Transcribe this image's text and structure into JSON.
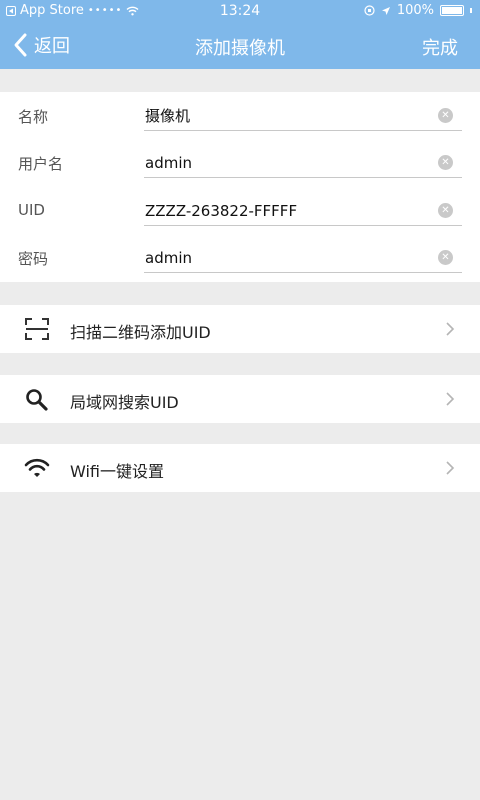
{
  "status_bar": {
    "carrier": "App Store",
    "signal": "•••••",
    "time": "13:24",
    "battery": "100%"
  },
  "nav": {
    "back_label": "返回",
    "title": "添加摄像机",
    "done_label": "完成"
  },
  "form": {
    "fields": [
      {
        "label": "名称",
        "value": "摄像机"
      },
      {
        "label": "用户名",
        "value": "admin"
      },
      {
        "label": "UID",
        "value": "ZZZZ-263822-FFFFF"
      },
      {
        "label": "密码",
        "value": "admin"
      }
    ]
  },
  "actions": [
    {
      "label": "扫描二维码添加UID",
      "icon": "qr-scan-icon"
    },
    {
      "label": "局域网搜索UID",
      "icon": "search-icon"
    },
    {
      "label": "Wifi一键设置",
      "icon": "wifi-icon"
    }
  ],
  "colors": {
    "nav_background": "#7fb8ea",
    "page_background": "#ececec"
  }
}
